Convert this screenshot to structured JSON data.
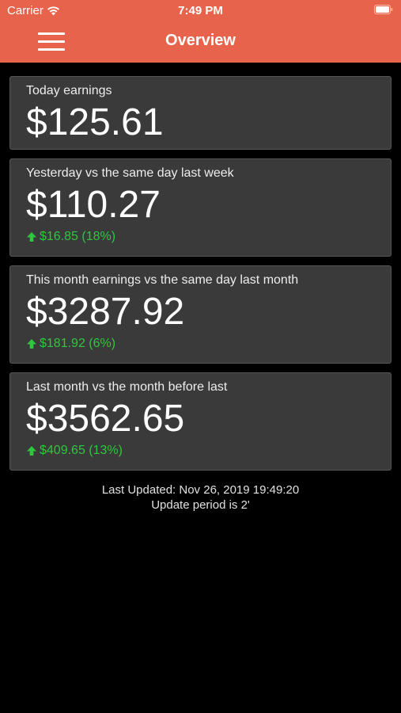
{
  "status_bar": {
    "carrier": "Carrier",
    "time": "7:49 PM"
  },
  "nav": {
    "title": "Overview",
    "menu_icon": "hamburger-menu-icon"
  },
  "colors": {
    "header": "#E8634C",
    "card_background": "#3A3A3A",
    "positive": "#2EC73E",
    "page_background": "#000000"
  },
  "cards": [
    {
      "label": "Today earnings",
      "value": "$125.61",
      "change": ""
    },
    {
      "label": "Yesterday vs the same day last week",
      "value": "$110.27",
      "change": "$16.85 (18%)",
      "trend_icon": "arrow-up-icon"
    },
    {
      "label": "This month earnings vs the same day last month",
      "value": "$3287.92",
      "change": "$181.92 (6%)",
      "trend_icon": "arrow-up-icon"
    },
    {
      "label": "Last month vs the month before last",
      "value": "$3562.65",
      "change": "$409.65 (13%)",
      "trend_icon": "arrow-up-icon"
    }
  ],
  "footer": {
    "last_updated": "Last Updated: Nov 26, 2019 19:49:20",
    "update_period": "Update period is 2'"
  }
}
